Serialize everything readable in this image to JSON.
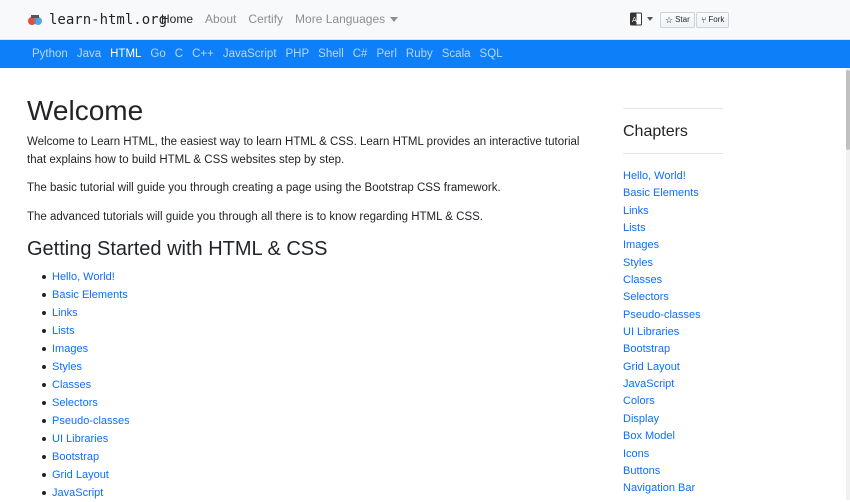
{
  "brand": {
    "name": "learn-html.org"
  },
  "topnav": {
    "home": "Home",
    "about": "About",
    "certify": "Certify",
    "more_languages": "More Languages"
  },
  "github": {
    "star": "Star",
    "fork": "Fork"
  },
  "langbar": {
    "items": [
      "Python",
      "Java",
      "HTML",
      "Go",
      "C",
      "C++",
      "JavaScript",
      "PHP",
      "Shell",
      "C#",
      "Perl",
      "Ruby",
      "Scala",
      "SQL"
    ],
    "active": "HTML"
  },
  "main": {
    "title": "Welcome",
    "intro": "Welcome to Learn HTML, the easiest way to learn HTML & CSS. Learn HTML provides an interactive tutorial that explains how to build HTML & CSS websites step by step.",
    "basic": "The basic tutorial will guide you through creating a page using the Bootstrap CSS framework.",
    "advanced": "The advanced tutorials will guide you through all there is to know regarding HTML & CSS.",
    "section_title": "Getting Started with HTML & CSS",
    "toc": [
      "Hello, World!",
      "Basic Elements",
      "Links",
      "Lists",
      "Images",
      "Styles",
      "Classes",
      "Selectors",
      "Pseudo-classes",
      "UI Libraries",
      "Bootstrap",
      "Grid Layout",
      "JavaScript"
    ]
  },
  "sidebar": {
    "title": "Chapters",
    "items": [
      "Hello, World!",
      "Basic Elements",
      "Links",
      "Lists",
      "Images",
      "Styles",
      "Classes",
      "Selectors",
      "Pseudo-classes",
      "UI Libraries",
      "Bootstrap",
      "Grid Layout",
      "JavaScript",
      "Colors",
      "Display",
      "Box Model",
      "Icons",
      "Buttons",
      "Navigation Bar"
    ]
  },
  "colors": {
    "accent": "#0d7ff8",
    "link": "#0d6efd"
  }
}
